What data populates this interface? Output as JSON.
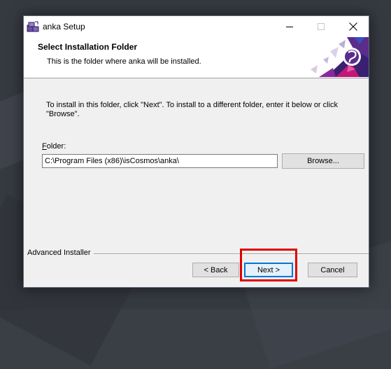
{
  "window": {
    "title": "anka Setup",
    "controls": {
      "minimize": "minimize-icon",
      "maximize": "maximize-icon",
      "close": "close-icon"
    }
  },
  "header": {
    "title": "Select Installation Folder",
    "subtitle": "This is the folder where anka will be installed."
  },
  "content": {
    "instructions": "To install in this folder, click \"Next\". To install to a different folder, enter it below or click \"Browse\".",
    "folder_label_mnemonic": "F",
    "folder_label_rest": "older:",
    "folder_path": "C:\\Program Files (x86)\\isCosmos\\anka\\",
    "browse_label": "Browse..."
  },
  "footer": {
    "brand": "Advanced Installer",
    "back_label": "< Back",
    "next_label": "Next >",
    "cancel_label": "Cancel"
  },
  "colors": {
    "highlight": "#e00000",
    "logo_purple": "#5a2d8c",
    "logo_magenta": "#c2187a",
    "logo_blue": "#3a4fb8"
  }
}
